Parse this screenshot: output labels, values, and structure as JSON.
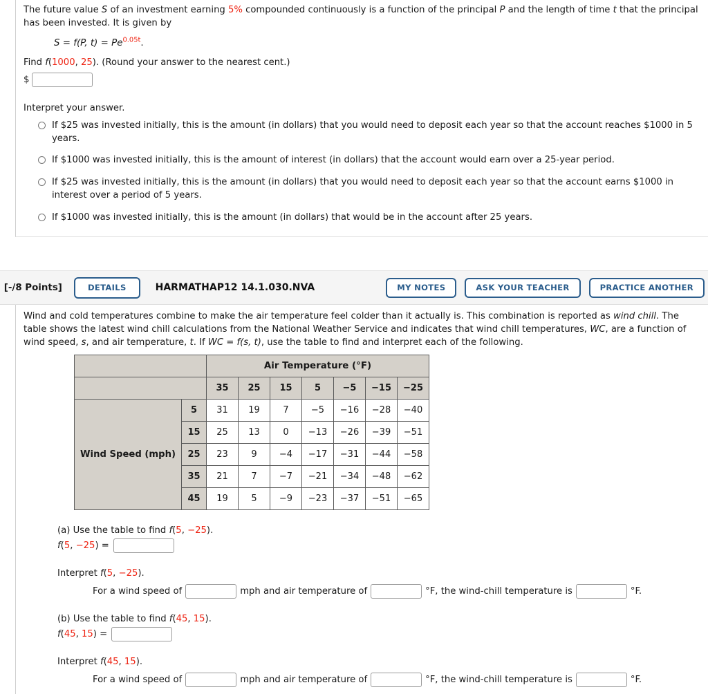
{
  "question1": {
    "intro_pre": "The future value ",
    "intro_S": "S",
    "intro_mid1": " of an investment earning ",
    "rate": "5%",
    "intro_mid2": " compounded continuously is a function of the principal ",
    "intro_P": "P",
    "intro_mid3": " and the length of time ",
    "intro_t": "t",
    "intro_end": " that the principal has been invested. It is given by",
    "formula": {
      "lhs": "S",
      "eq1": " = ",
      "f": "f",
      "args": "(P, t)",
      "eq2": " = ",
      "base": "Pe",
      "exponent": "0.05t",
      "period": "."
    },
    "find_pre": "Find ",
    "find_f": "f",
    "find_paren_open": "(",
    "find_arg1": "1000",
    "find_comma": ", ",
    "find_arg2": "25",
    "find_paren_close": ")",
    "find_post": ". (Round your answer to the nearest cent.)",
    "dollar_sign": "$",
    "answer_value": "",
    "interpret_heading": "Interpret your answer.",
    "options": [
      "If $25 was invested initially, this is the amount (in dollars) that you would need to deposit each year so that the account reaches $1000 in 5 years.",
      "If $1000 was invested initially, this is the amount of interest (in dollars) that the account would earn over a 25-year period.",
      "If $25 was invested initially, this is the amount (in dollars) that you would need to deposit each year so that the account earns $1000 in interest over a period of 5 years.",
      "If $1000 was invested initially, this is the amount (in dollars) that would be in the account after 25 years."
    ]
  },
  "question2": {
    "header": {
      "points": ". [-/8 Points]",
      "details_label": "DETAILS",
      "code": "HARMATHAP12 14.1.030.NVA",
      "my_notes_label": "MY NOTES",
      "ask_teacher_label": "ASK YOUR TEACHER",
      "practice_label": "PRACTICE ANOTHER"
    },
    "intro_1": "Wind and cold temperatures combine to make the air temperature feel colder than it actually is. This combination is reported as ",
    "intro_italic_1": "wind chill",
    "intro_2": ". The table shows the latest wind chill calculations from the National Weather Service and indicates that wind chill temperatures, ",
    "intro_wc": "WC",
    "intro_3": ", are a function of wind speed, ",
    "intro_s": "s",
    "intro_4": ", and air temperature, ",
    "intro_t": "t",
    "intro_5": ". If ",
    "intro_wc2": "WC",
    "intro_6": " = ",
    "intro_f": "f",
    "intro_st": "(s, t)",
    "intro_7": ", use the table to find and interpret each of the following.",
    "table": {
      "col_group_header": "Air Temperature (°F)",
      "row_group_header": "Wind Speed (mph)",
      "col_headers": [
        "35",
        "25",
        "15",
        "5",
        "−5",
        "−15",
        "−25"
      ],
      "row_headers": [
        "5",
        "15",
        "25",
        "35",
        "45"
      ],
      "rows": [
        [
          "31",
          "19",
          "7",
          "−5",
          "−16",
          "−28",
          "−40"
        ],
        [
          "25",
          "13",
          "0",
          "−13",
          "−26",
          "−39",
          "−51"
        ],
        [
          "23",
          "9",
          "−4",
          "−17",
          "−31",
          "−44",
          "−58"
        ],
        [
          "21",
          "7",
          "−7",
          "−21",
          "−34",
          "−48",
          "−62"
        ],
        [
          "19",
          "5",
          "−9",
          "−23",
          "−37",
          "−51",
          "−65"
        ]
      ]
    },
    "parts": [
      {
        "label": "(a) Use the table to find ",
        "fn": "f",
        "paren_open": "(",
        "arg1": "5",
        "comma": ", ",
        "arg2": "−25",
        "paren_close": ")",
        "period": ".",
        "eq_suffix": " = ",
        "answer_value": "",
        "interpret_prefix": "Interpret ",
        "interpret_period": ".",
        "sentence_1": "For a wind speed of",
        "sentence_2": "mph and air temperature of",
        "sentence_3": "°F, the wind-chill temperature is",
        "sentence_4": "°F.",
        "speed_value": "",
        "temp_value": "",
        "wc_value": ""
      },
      {
        "label": "(b) Use the table to find ",
        "fn": "f",
        "paren_open": "(",
        "arg1": "45",
        "comma": ", ",
        "arg2": "15",
        "paren_close": ")",
        "period": ".",
        "eq_suffix": " = ",
        "answer_value": "",
        "interpret_prefix": "Interpret ",
        "interpret_period": ".",
        "sentence_1": "For a wind speed of",
        "sentence_2": "mph and air temperature of",
        "sentence_3": "°F, the wind-chill temperature is",
        "sentence_4": "°F.",
        "speed_value": "",
        "temp_value": "",
        "wc_value": ""
      }
    ]
  },
  "colors": {
    "accent_red": "#ee2211",
    "button_blue": "#2b5d8c",
    "table_beige": "#d5d1ca",
    "header_bar": "#f5f5f5"
  }
}
